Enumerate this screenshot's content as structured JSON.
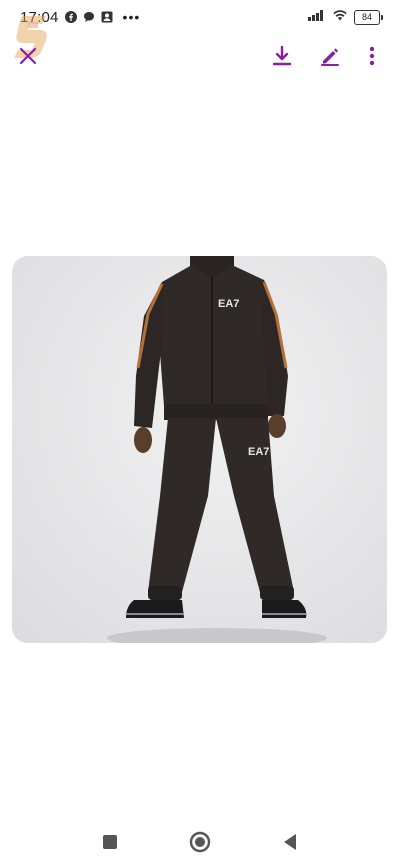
{
  "status_bar": {
    "time": "17:04",
    "dots": "•••",
    "battery": "84",
    "icons": [
      "facebook-icon",
      "chat-bubble-icon",
      "contact-card-icon",
      "signal-icon",
      "wifi-icon",
      "battery-icon"
    ]
  },
  "toolbar": {
    "close_icon": "close-icon",
    "download_icon": "download-icon",
    "edit_icon": "edit-icon",
    "more_icon": "more-vertical-icon",
    "accent_color": "#8a1ea8"
  },
  "photo": {
    "brand_label": "EA7",
    "background_color": "#e9e9ea",
    "garment_color": "#2f2a27",
    "trim_color": "#b4703a"
  },
  "nav": {
    "recents_icon": "square-icon",
    "home_icon": "circle-home-icon",
    "back_icon": "back-triangle-icon"
  }
}
